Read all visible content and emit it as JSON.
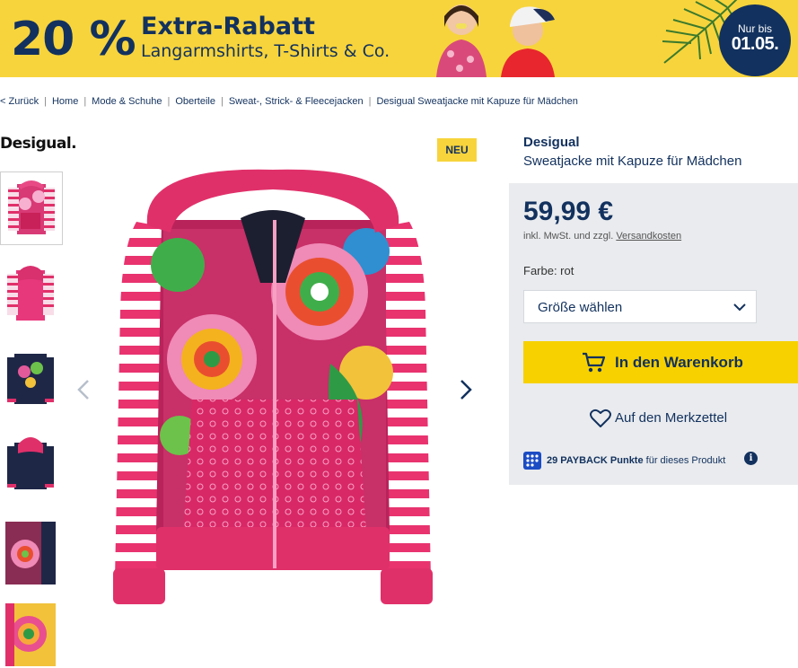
{
  "banner": {
    "percent": "20 %",
    "title": "Extra-Rabatt",
    "subtitle": "Langarmshirts, T-Shirts & Co.",
    "badge_line1": "Nur bis",
    "badge_line2": "01.05."
  },
  "breadcrumb": {
    "back": "< Zurück",
    "items": [
      "Home",
      "Mode & Schuhe",
      "Oberteile",
      "Sweat-, Strick- & Fleecejacken",
      "Desigual Sweatjacke mit Kapuze für Mädchen"
    ]
  },
  "brand_logo": "Desigual.",
  "badge_new": "NEU",
  "product": {
    "brand": "Desigual",
    "name": "Sweatjacke mit Kapuze für Mädchen",
    "price": "59,99 €",
    "price_note_prefix": "inkl. MwSt. und zzgl.",
    "shipping_link": "Versandkosten",
    "color_label": "Farbe: rot",
    "size_select": "Größe wählen",
    "cart_button": "In den Warenkorb",
    "wishlist_button": "Auf den Merkzettel",
    "payback_points": "29 PAYBACK Punkte",
    "payback_suffix": "für dieses Produkt"
  },
  "colors": {
    "banner_yellow": "#f7d43c",
    "navy": "#12315e",
    "cart_yellow": "#f7d100",
    "pink": "#e0306a",
    "buybox_gray": "#e9ebee"
  },
  "icons": {
    "prev": "chevron-left-icon",
    "next": "chevron-right-icon",
    "select": "chevron-down-icon",
    "cart": "cart-icon",
    "wishlist": "heart-icon",
    "payback": "payback-icon",
    "info": "info-icon"
  }
}
